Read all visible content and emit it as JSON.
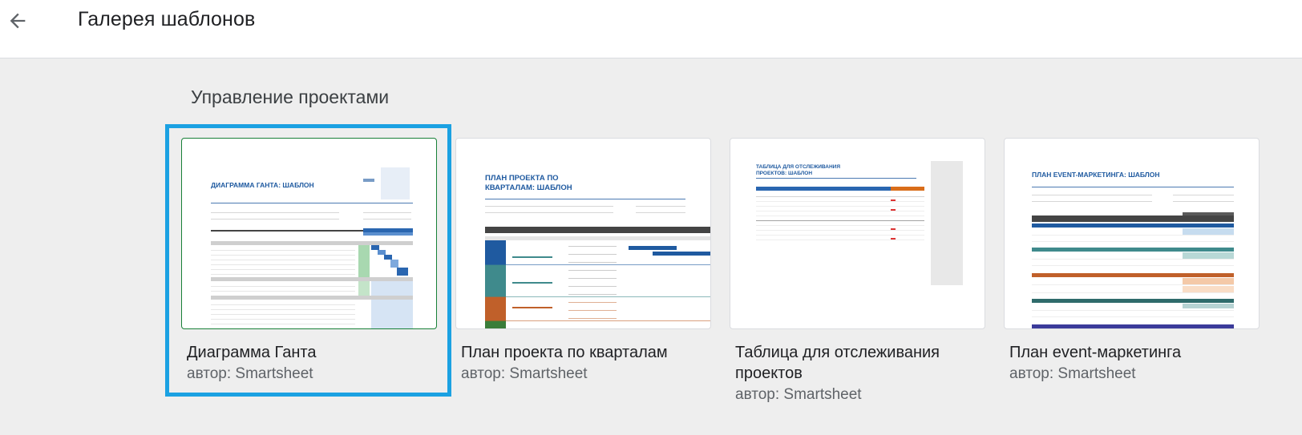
{
  "header": {
    "title": "Галерея шаблонов",
    "back_icon": "arrow-back-icon"
  },
  "section": {
    "title": "Управление проектами"
  },
  "templates": [
    {
      "name": "Диаграмма Ганта",
      "author": "автор: Smartsheet",
      "thumb_title": "ДИАГРАММА ГАНТА: ШАБЛОН",
      "selected": true
    },
    {
      "name": "План проекта по кварталам",
      "author": "автор: Smartsheet",
      "thumb_title_1": "ПЛАН ПРОЕКТА ПО",
      "thumb_title_2": "КВАРТАЛАМ: ШАБЛОН",
      "selected": false
    },
    {
      "name": "Таблица для отслеживания проектов",
      "author": "автор: Smartsheet",
      "thumb_title_1": "ТАБЛИЦА ДЛЯ ОТСЛЕЖИВАНИЯ",
      "thumb_title_2": "ПРОЕКТОВ: ШАБЛОН",
      "selected": false
    },
    {
      "name": "План event-маркетинга",
      "author": "автор: Smartsheet",
      "thumb_title": "ПЛАН EVENT-МАРКЕТИНГА: ШАБЛОН",
      "selected": false
    }
  ],
  "colors": {
    "selection": "#1ba1e2",
    "template_blue": "#1f5aa0"
  }
}
